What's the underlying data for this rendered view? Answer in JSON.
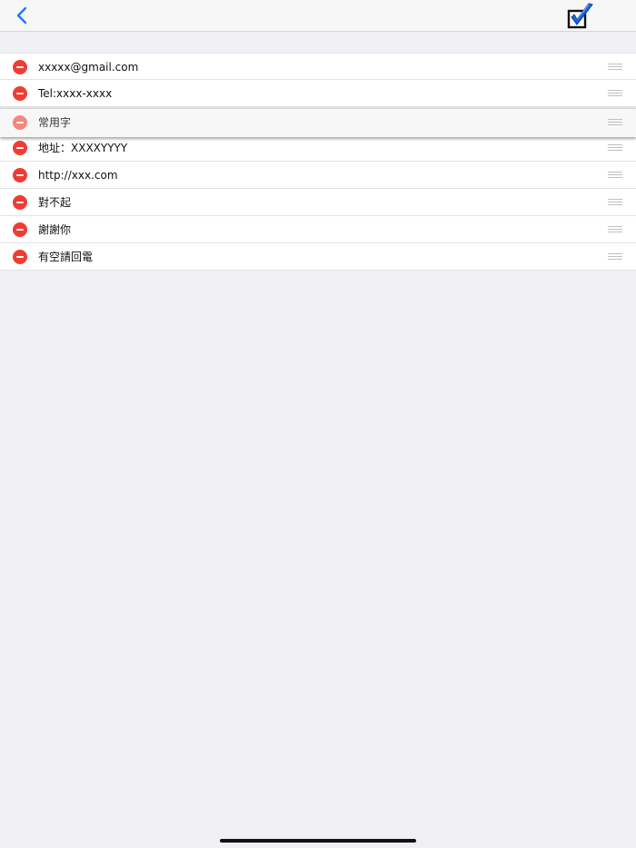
{
  "navbar": {
    "back_icon": "chevron-left-icon",
    "done_icon": "checkbox-checked-icon",
    "accent": "#1a7cf0"
  },
  "list": {
    "items": [
      {
        "label": "xxxxx@gmail.com"
      },
      {
        "label": "Tel:xxxx-xxxx"
      },
      {
        "label": "常用字",
        "state": "dragging"
      },
      {
        "label": "地址：XXXXYYYY"
      },
      {
        "label": "http://xxx.com"
      },
      {
        "label": "對不起"
      },
      {
        "label": "謝謝你"
      },
      {
        "label": "有空請回電"
      }
    ],
    "delete_icon": "minus-circle-icon",
    "reorder_icon": "reorder-grip-icon",
    "delete_color": "#f03c33"
  }
}
